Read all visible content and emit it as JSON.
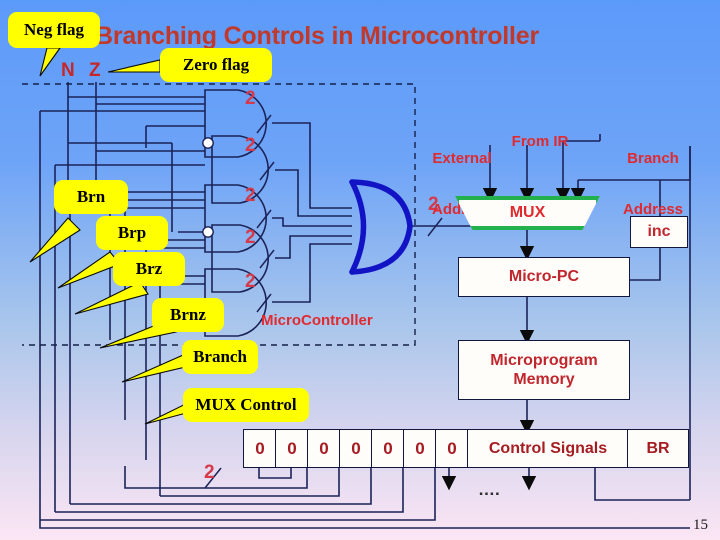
{
  "slide": {
    "title": "Branching Controls in Microcontroller",
    "page_number": "15",
    "colors": {
      "title": "#c0392b",
      "label_red": "#e02a2f",
      "annotation_red": "#d63a4a",
      "callout_fill": "#ffff00",
      "wire": "#1b2358",
      "or_gate": "#1313c6",
      "mux_border": "#22b14c",
      "bg_top": "#5c9afa",
      "bg_bottom": "#fbe6f4"
    }
  },
  "flags": {
    "neg": "N",
    "zero": "Z"
  },
  "callouts": [
    {
      "id": "neg-flag",
      "label": "Neg flag"
    },
    {
      "id": "zero-flag",
      "label": "Zero flag"
    },
    {
      "id": "brn",
      "label": "Brn"
    },
    {
      "id": "brp",
      "label": "Brp"
    },
    {
      "id": "brz",
      "label": "Brz"
    },
    {
      "id": "brnz",
      "label": "Brnz"
    },
    {
      "id": "branch",
      "label": "Branch"
    },
    {
      "id": "mux-control",
      "label": "MUX Control"
    }
  ],
  "bus_width_labels": {
    "gate1": "2",
    "gate2": "2",
    "gate3": "2",
    "gate4": "2",
    "gate5": "2",
    "or_out": "2",
    "mux_control": "2"
  },
  "datapath": {
    "external_address": "External\nAddress",
    "external_address_line1": "External",
    "external_address_line2": "Address",
    "from_ir": "From IR",
    "branch_address_line1": "Branch",
    "branch_address_line2": "Address",
    "mux": "MUX",
    "inc": "inc",
    "micro_pc": "Micro-PC",
    "microprogram_memory_line1": "Microprogram",
    "microprogram_memory_line2": "Memory",
    "microcontroller_region": "MicroController"
  },
  "control_word": {
    "bits": [
      "0",
      "0",
      "0",
      "0",
      "0",
      "0",
      "0"
    ],
    "control_signals_label": "Control Signals",
    "br_label": "BR",
    "ellipsis": "…."
  }
}
